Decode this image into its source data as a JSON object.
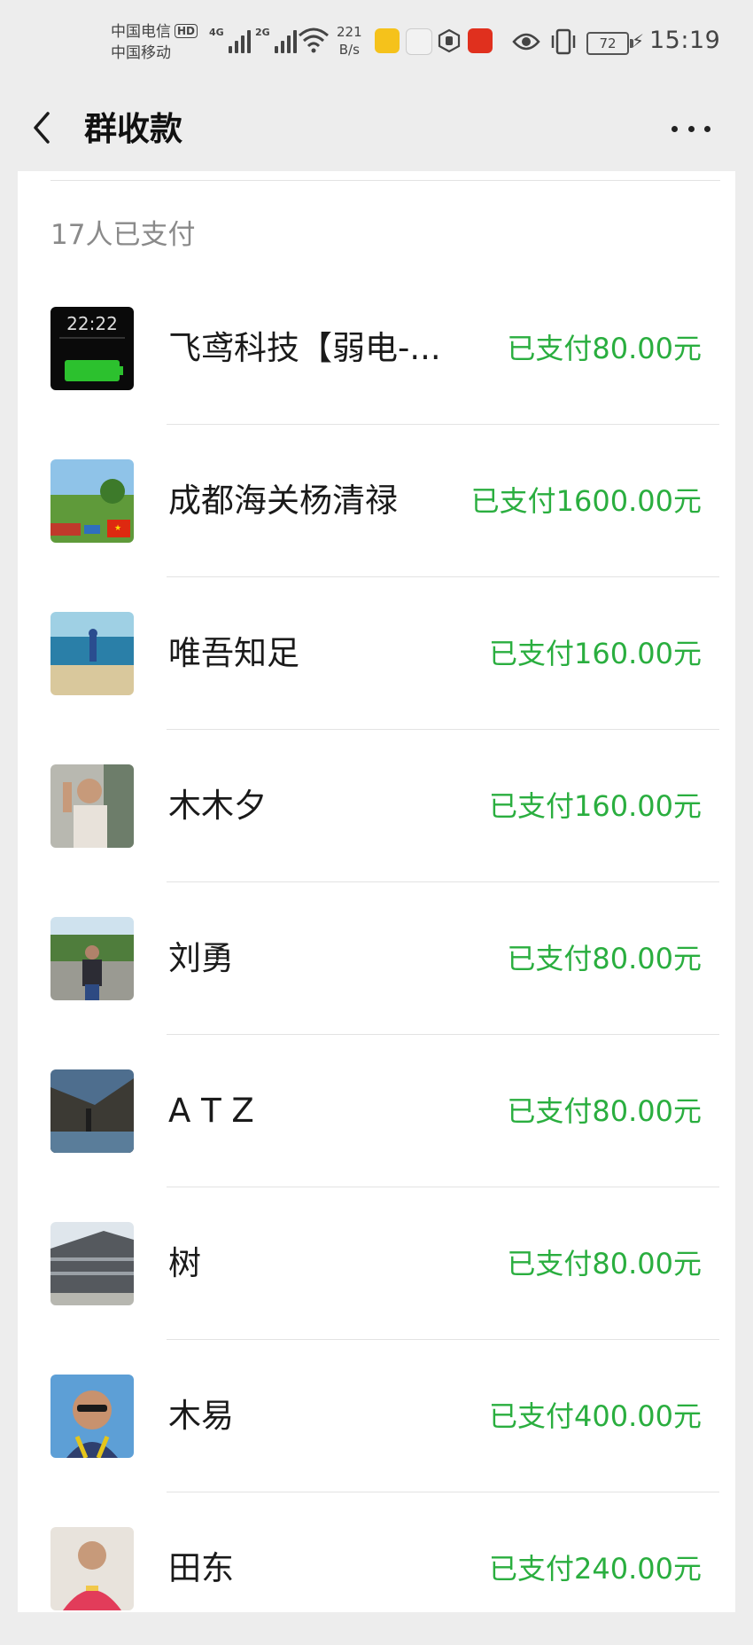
{
  "status_bar": {
    "carrier1": "中国电信",
    "hd_badge": "HD",
    "carrier2": "中国移动",
    "signal1_label": "4G",
    "signal2_label": "2G",
    "speed_value": "221",
    "speed_unit": "B/s",
    "battery": "72",
    "time": "15:19"
  },
  "nav": {
    "title": "群收款"
  },
  "paid_section": {
    "count_label": "17人已支付",
    "members": [
      {
        "name": "飞鸢科技【弱电-...",
        "amount": "已支付80.00元",
        "avatar": "phone-lockscreen-avatar",
        "lock_time": "22:22"
      },
      {
        "name": "成都海关杨清禄",
        "amount": "已支付1600.00元",
        "avatar": "landscape-flag-avatar"
      },
      {
        "name": "唯吾知足",
        "amount": "已支付160.00元",
        "avatar": "beach-avatar"
      },
      {
        "name": "木木夕",
        "amount": "已支付160.00元",
        "avatar": "person-photo-avatar"
      },
      {
        "name": "刘勇",
        "amount": "已支付80.00元",
        "avatar": "person-park-avatar"
      },
      {
        "name": "A T Z",
        "amount": "已支付80.00元",
        "avatar": "river-avatar"
      },
      {
        "name": "树",
        "amount": "已支付80.00元",
        "avatar": "building-avatar"
      },
      {
        "name": "木易",
        "amount": "已支付400.00元",
        "avatar": "sunglasses-avatar"
      },
      {
        "name": "田东",
        "amount": "已支付240.00元",
        "avatar": "red-shirt-avatar"
      }
    ]
  },
  "colors": {
    "paid_green": "#2aae3f",
    "page_bg": "#ededed",
    "card_bg": "#ffffff"
  }
}
